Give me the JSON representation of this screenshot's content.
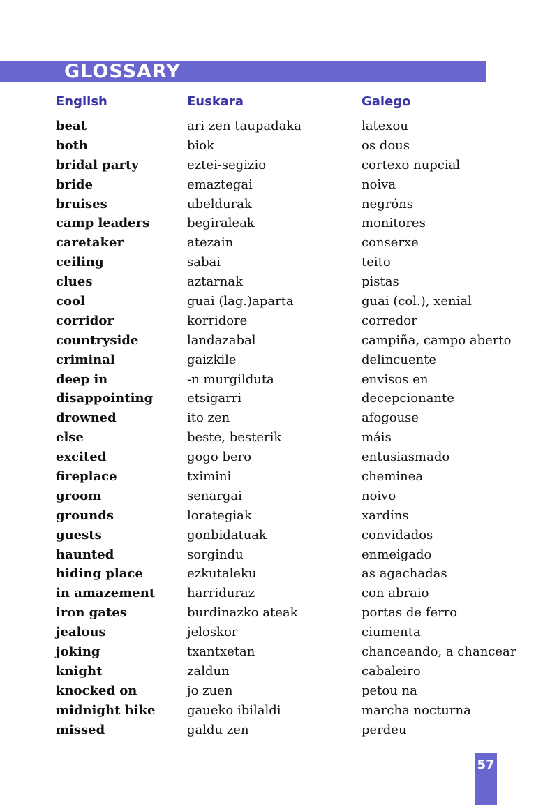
{
  "title": "GLOSSARY",
  "headers": {
    "english": "English",
    "euskara": "Euskara",
    "galego": "Galego"
  },
  "entries": [
    {
      "en": "beat",
      "eu": "ari zen taupadaka",
      "gl": "latexou"
    },
    {
      "en": "both",
      "eu": "biok",
      "gl": "os dous"
    },
    {
      "en": "bridal party",
      "eu": "eztei-segizio",
      "gl": "cortexo nupcial"
    },
    {
      "en": "bride",
      "eu": "emaztegai",
      "gl": "noiva"
    },
    {
      "en": "bruises",
      "eu": "ubeldurak",
      "gl": "negróns"
    },
    {
      "en": "camp leaders",
      "eu": "begiraleak",
      "gl": "monitores"
    },
    {
      "en": "caretaker",
      "eu": "atezain",
      "gl": "conserxe"
    },
    {
      "en": "ceiling",
      "eu": "sabai",
      "gl": "teito"
    },
    {
      "en": "clues",
      "eu": "aztarnak",
      "gl": "pistas"
    },
    {
      "en": "cool",
      "eu": "guai (lag.)aparta",
      "gl": "guai (col.), xenial"
    },
    {
      "en": "corridor",
      "eu": "korridore",
      "gl": "corredor"
    },
    {
      "en": "countryside",
      "eu": "landazabal",
      "gl": "campiña, campo aberto"
    },
    {
      "en": "criminal",
      "eu": "gaizkile",
      "gl": "delincuente"
    },
    {
      "en": "deep in",
      "eu": "-n murgilduta",
      "gl": "envisos en"
    },
    {
      "en": "disappointing",
      "eu": "etsigarri",
      "gl": "decepcionante"
    },
    {
      "en": "drowned",
      "eu": "ito zen",
      "gl": "afogouse"
    },
    {
      "en": "else",
      "eu": "beste, besterik",
      "gl": "máis"
    },
    {
      "en": "excited",
      "eu": "gogo bero",
      "gl": "entusiasmado"
    },
    {
      "en": "fireplace",
      "eu": "tximini",
      "gl": "cheminea"
    },
    {
      "en": "groom",
      "eu": "senargai",
      "gl": "noivo"
    },
    {
      "en": "grounds",
      "eu": "lorategiak",
      "gl": "xardíns"
    },
    {
      "en": "guests",
      "eu": "gonbidatuak",
      "gl": "convidados"
    },
    {
      "en": "haunted",
      "eu": "sorgindu",
      "gl": "enmeigado"
    },
    {
      "en": "hiding place",
      "eu": "ezkutaleku",
      "gl": "as agachadas"
    },
    {
      "en": "in amazement",
      "eu": "harriduraz",
      "gl": "con abraio"
    },
    {
      "en": "iron gates",
      "eu": "burdinazko ateak",
      "gl": "portas de ferro"
    },
    {
      "en": "jealous",
      "eu": "jeloskor",
      "gl": "ciumenta"
    },
    {
      "en": "joking",
      "eu": "txantxetan",
      "gl": "chanceando, a chancear"
    },
    {
      "en": "knight",
      "eu": "zaldun",
      "gl": "cabaleiro"
    },
    {
      "en": "knocked on",
      "eu": "jo zuen",
      "gl": "petou na"
    },
    {
      "en": "midnight hike",
      "eu": "gaueko ibilaldi",
      "gl": "marcha nocturna"
    },
    {
      "en": "missed",
      "eu": "galdu zen",
      "gl": "perdeu"
    }
  ],
  "page_number": "57",
  "colors": {
    "accent": "#6a66cf",
    "header_text": "#3a36a6"
  }
}
